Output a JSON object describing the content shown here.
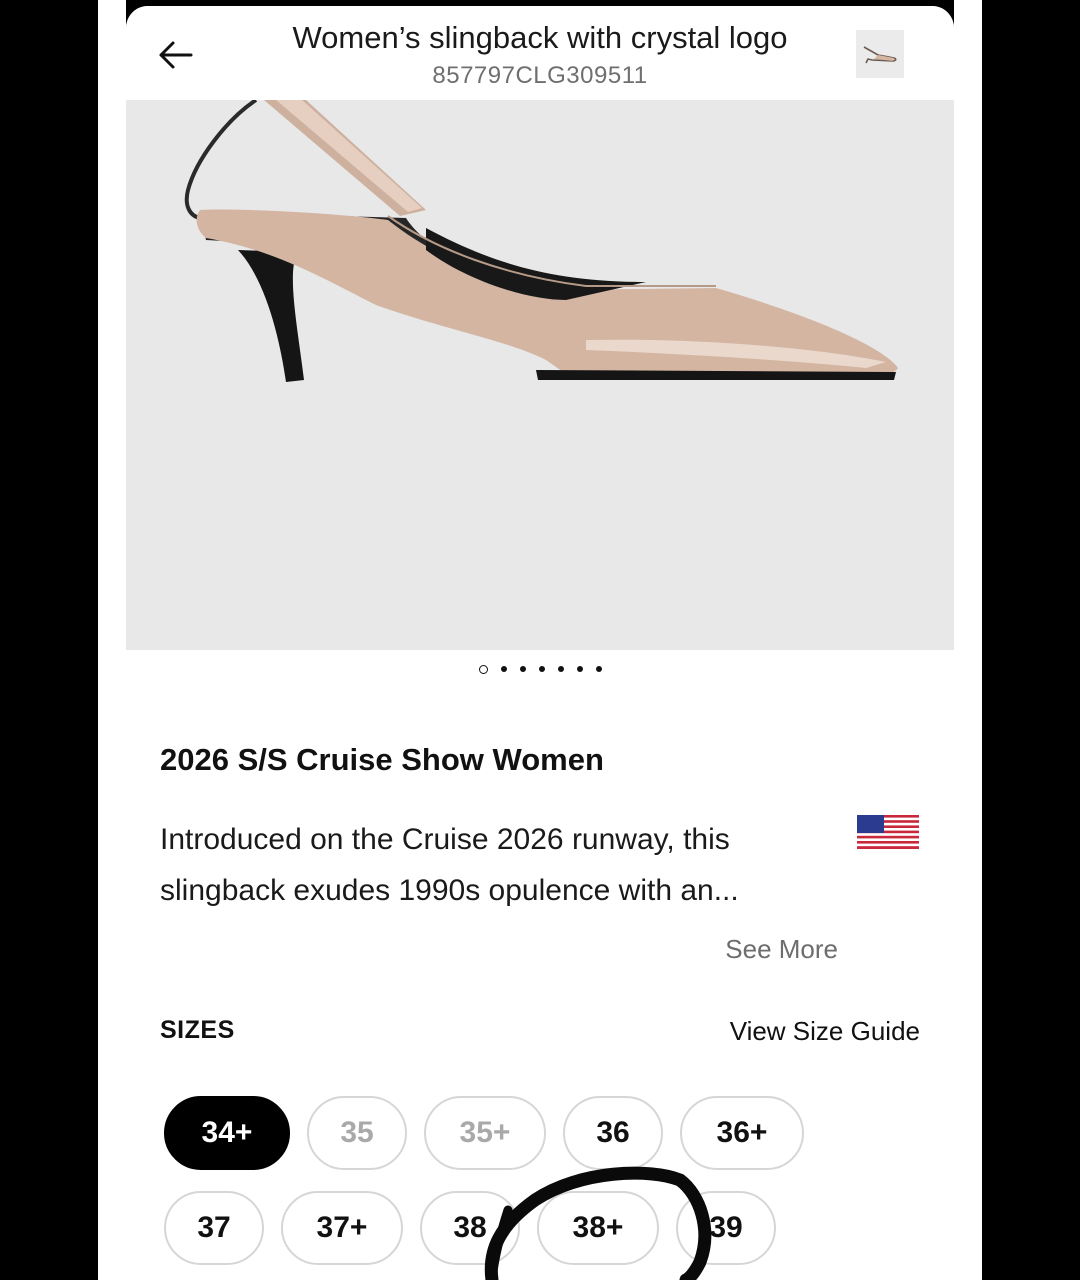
{
  "header": {
    "title": "Women’s slingback with crystal logo",
    "sku": "857797CLG309511",
    "back_icon": "arrow-left-icon",
    "thumbnail_icon": "shoe-thumbnail"
  },
  "gallery": {
    "image": "beige-patent-slingback-pump",
    "image_count": 7,
    "active_index": 0
  },
  "collection": {
    "heading": "2026 S/S Cruise Show Women"
  },
  "description": {
    "line1": "Introduced on the Cruise 2026 runway, this",
    "line2": "slingback exudes 1990s opulence with an...",
    "see_more": "See More",
    "flag_icon": "us-flag-icon"
  },
  "sizes": {
    "label": "SIZES",
    "guide_link": "View Size Guide",
    "row1": [
      {
        "label": "34+",
        "state": "selected"
      },
      {
        "label": "35",
        "state": "unavailable"
      },
      {
        "label": "35+",
        "state": "unavailable"
      },
      {
        "label": "36",
        "state": "available"
      },
      {
        "label": "36+",
        "state": "available"
      }
    ],
    "row2": [
      {
        "label": "37",
        "state": "available"
      },
      {
        "label": "37+",
        "state": "available"
      },
      {
        "label": "38",
        "state": "available"
      },
      {
        "label": "38+",
        "state": "available"
      },
      {
        "label": "39",
        "state": "available"
      }
    ]
  },
  "colors": {
    "accent": "#000000",
    "shoe_body": "#d3b5a2",
    "hero_background": "#e8e8e8",
    "annotation_ink": "#0a0a0a"
  }
}
